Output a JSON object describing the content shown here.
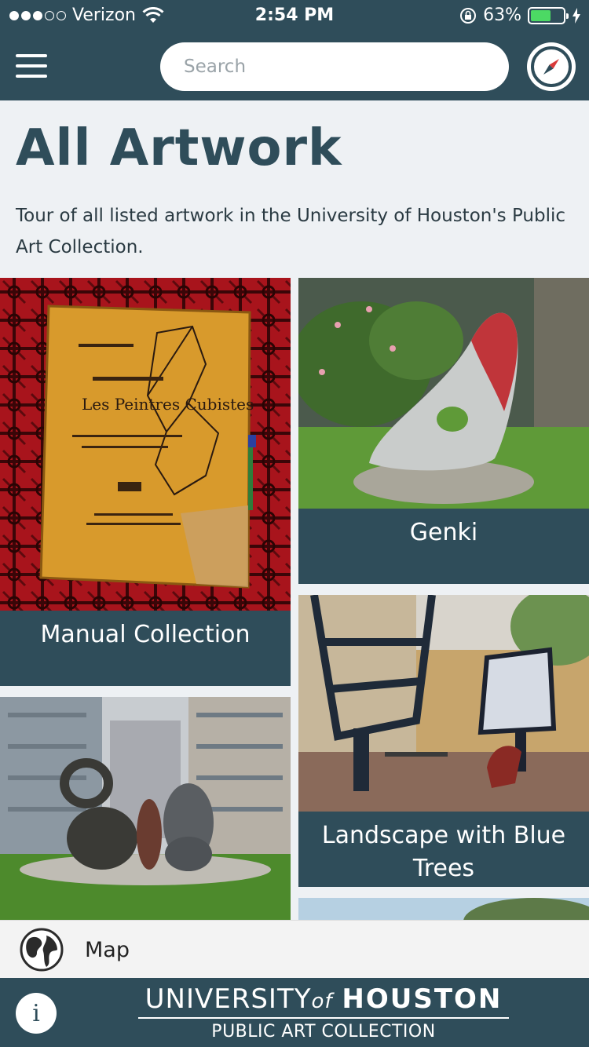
{
  "status_bar": {
    "carrier": "Verizon",
    "time": "2:54 PM",
    "battery_percent": "63%",
    "battery_level": 0.63,
    "signal_bars_filled": 3,
    "signal_bars_total": 5
  },
  "nav": {
    "search_placeholder": "Search"
  },
  "header": {
    "title": "All Artwork",
    "description": "Tour of all listed artwork in the University of Houston's Public Art Collection."
  },
  "artworks": [
    {
      "title": "Manual Collection"
    },
    {
      "title": "Genki"
    },
    {
      "title": "Landscape with Blue Trees"
    }
  ],
  "map_bar": {
    "label": "Map"
  },
  "footer": {
    "brand_university": "UNIVERSITY",
    "brand_of": "of",
    "brand_houston": "HOUSTON",
    "brand_subtitle": "PUBLIC ART COLLECTION",
    "info_label": "i"
  },
  "colors": {
    "primary": "#2f4d5a",
    "background": "#eef1f4",
    "battery": "#4cd964"
  },
  "icons": [
    "menu-icon",
    "compass-icon",
    "globe-icon",
    "info-icon",
    "wifi-icon",
    "lock-rotation-icon",
    "charging-icon"
  ]
}
